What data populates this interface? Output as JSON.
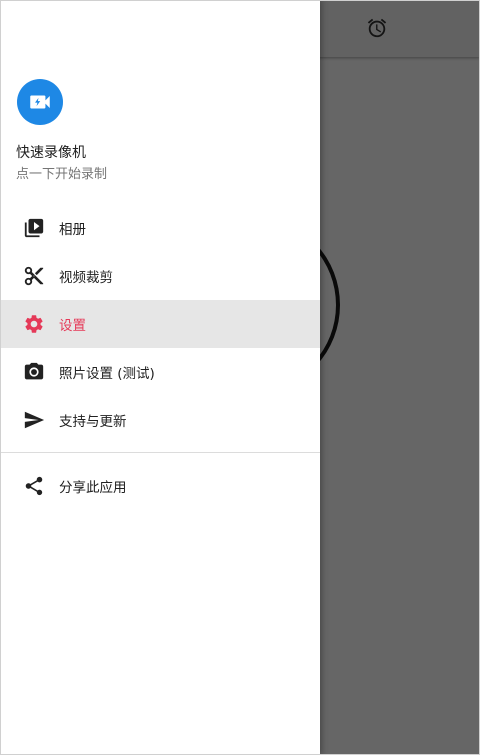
{
  "app": {
    "title": "快速录像机",
    "subtitle": "点一下开始录制"
  },
  "menu": [
    {
      "label": "相册",
      "icon": "video-library-icon"
    },
    {
      "label": "视频裁剪",
      "icon": "scissors-icon"
    },
    {
      "label": "设置",
      "icon": "gear-icon",
      "active": true
    },
    {
      "label": "照片设置 (测试)",
      "icon": "camera-icon"
    },
    {
      "label": "支持与更新",
      "icon": "send-icon"
    }
  ],
  "secondary_menu": [
    {
      "label": "分享此应用",
      "icon": "share-icon"
    }
  ],
  "colors": {
    "accent": "#e53958",
    "app_icon_bg": "#1e88e5",
    "active_bg": "#e6e6e6"
  }
}
